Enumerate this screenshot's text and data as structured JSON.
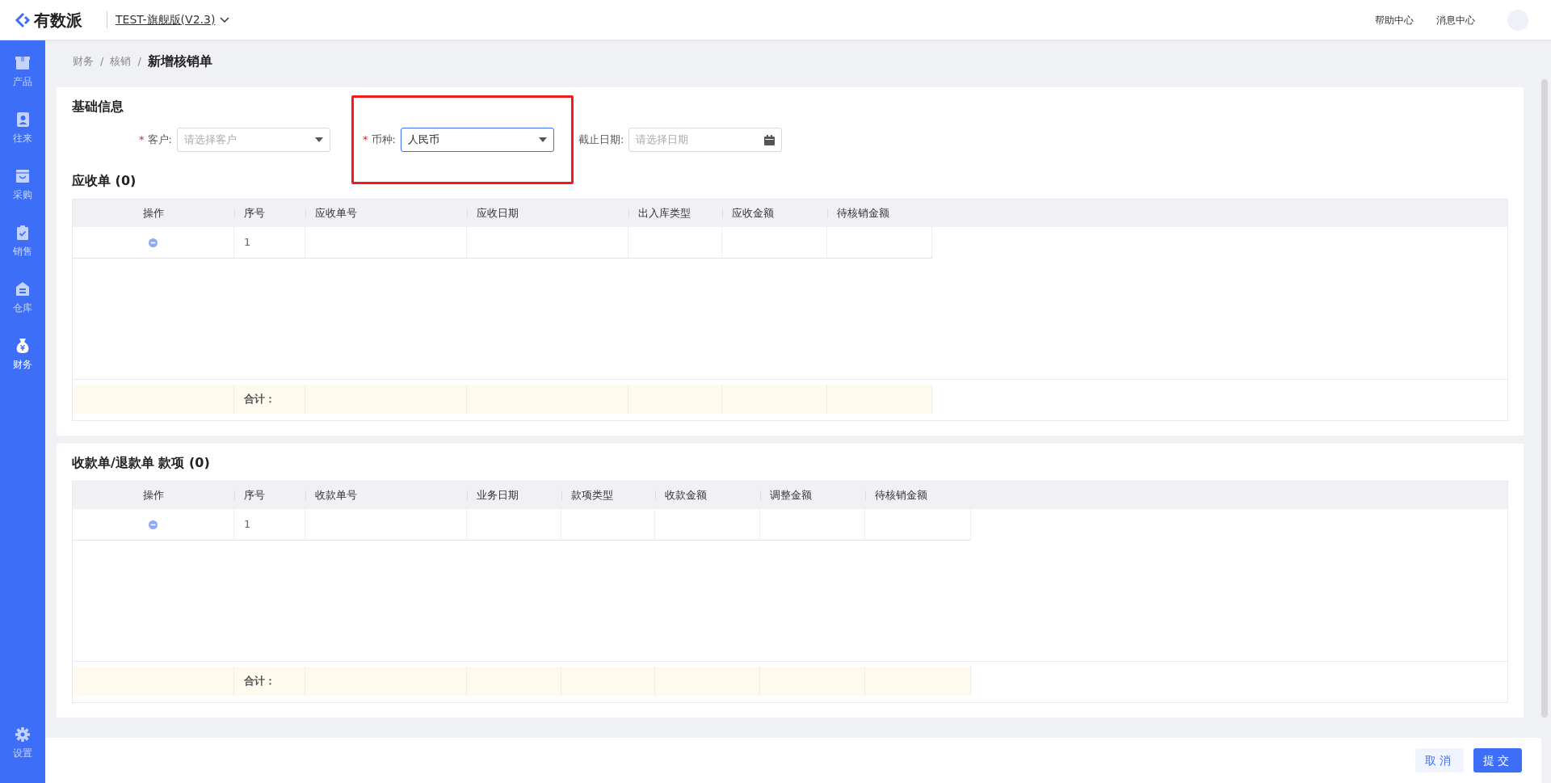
{
  "app": {
    "logo": "有数派",
    "version": "TEST-旗舰版(V2.3)"
  },
  "header_links": [
    "帮助中心",
    "消息中心"
  ],
  "sidebar": {
    "items": [
      {
        "label": "产品",
        "kind": "box",
        "selected": false
      },
      {
        "label": "往来",
        "kind": "contact",
        "selected": false
      },
      {
        "label": "采购",
        "kind": "bag",
        "selected": false
      },
      {
        "label": "销售",
        "kind": "clipboard",
        "selected": false
      },
      {
        "label": "仓库",
        "kind": "house",
        "selected": false
      },
      {
        "label": "财务",
        "kind": "money",
        "selected": true
      }
    ],
    "bottom_items": [
      {
        "label": "设置",
        "kind": "gear",
        "selected": false
      }
    ]
  },
  "breadcrumb": [
    "财务",
    "核销",
    "新增核销单"
  ],
  "breadcrumb_separator": "/",
  "basic_info": {
    "title": "基础信息",
    "required_mark": "*",
    "fields": [
      {
        "label": "客户:",
        "required": true,
        "kind": "select",
        "placeholder": "请选择客户",
        "focused": false,
        "highlighted": false
      },
      {
        "label": "币种:",
        "required": true,
        "kind": "select",
        "value": "人民币",
        "focused": true,
        "highlighted": true
      },
      {
        "label": "截止日期:",
        "required": false,
        "kind": "date",
        "placeholder": "请选择日期",
        "focused": false,
        "highlighted": false
      }
    ]
  },
  "tables": [
    {
      "title": "应收单",
      "count": "(0)",
      "columns": [
        "操作",
        "序号",
        "应收单号",
        "应收日期",
        "出入库类型",
        "应收金额",
        "待核销金额"
      ],
      "rows": [
        {
          "index": "1"
        }
      ],
      "footer_label": "合计："
    },
    {
      "title": "收款单/退款单 款项",
      "count": "(0)",
      "columns": [
        "操作",
        "序号",
        "收款单号",
        "业务日期",
        "款项类型",
        "收款金额",
        "调整金额",
        "待核销金额"
      ],
      "rows": [
        {
          "index": "1"
        }
      ],
      "footer_label": "合计："
    }
  ],
  "buttons": [
    {
      "label": "取消",
      "kind": "secondary"
    },
    {
      "label": "提交",
      "kind": "primary"
    }
  ]
}
